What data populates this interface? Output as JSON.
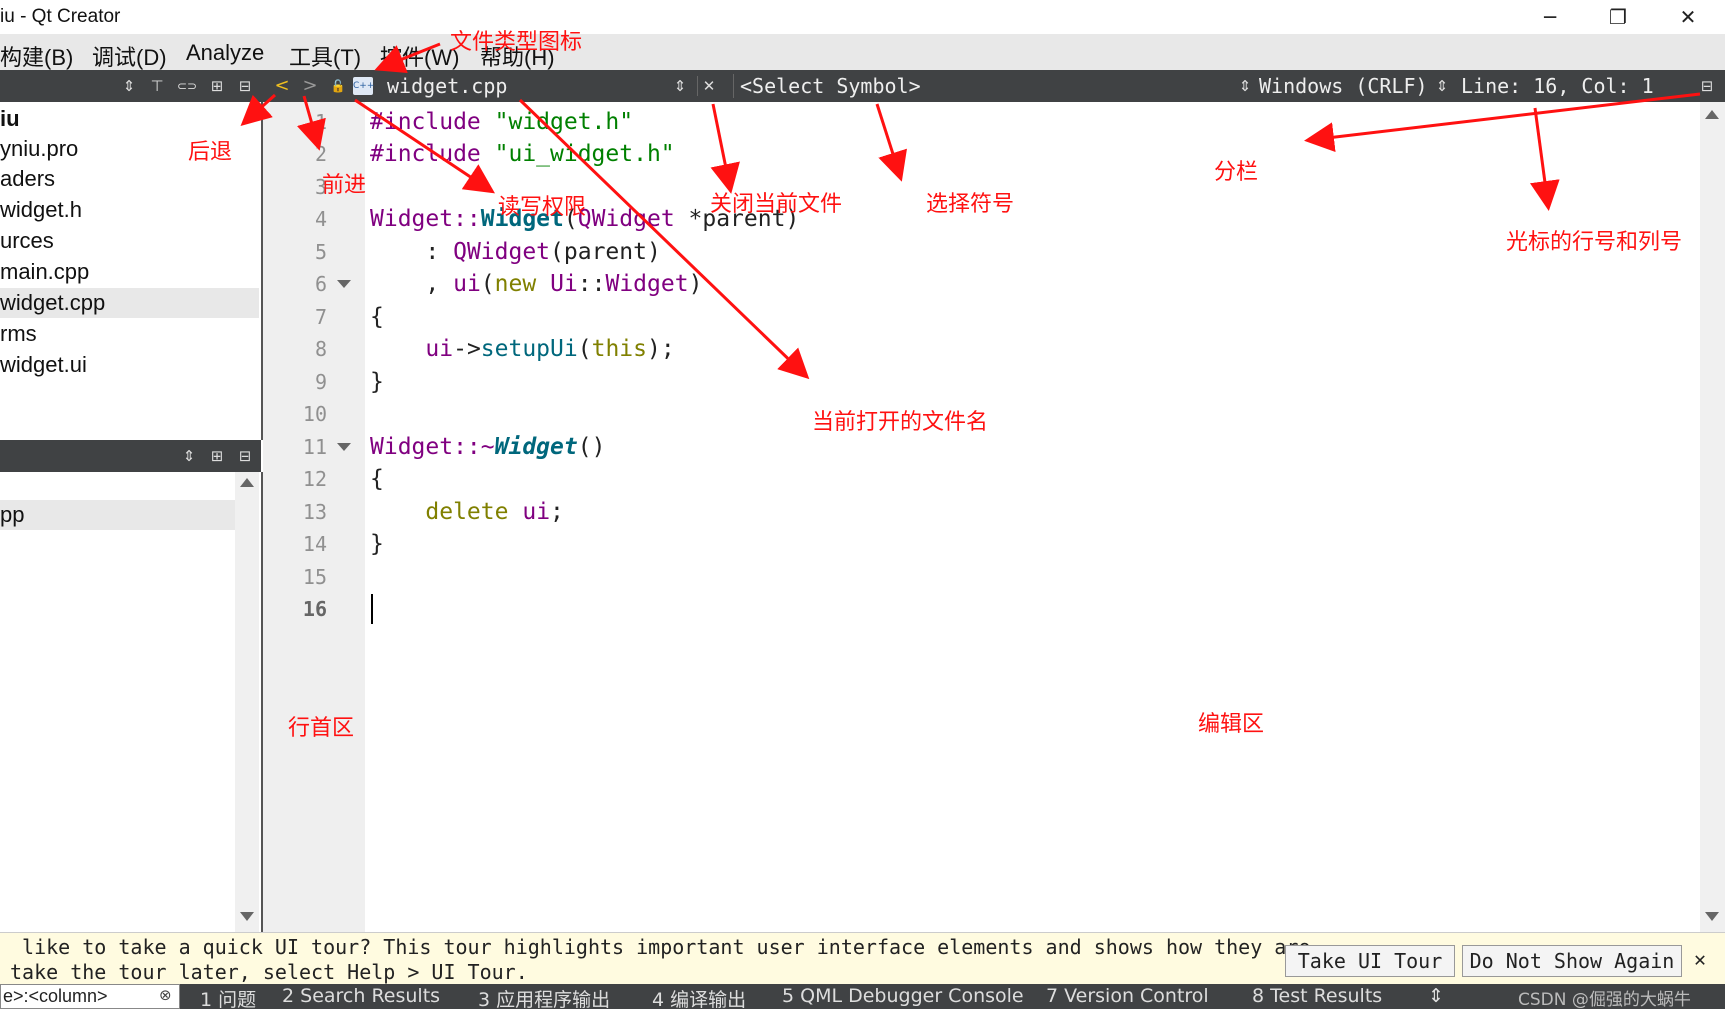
{
  "window": {
    "title": "iu - Qt Creator",
    "minimize": "─",
    "restore": "❐",
    "close": "✕"
  },
  "menu": [
    "构建(B)",
    "调试(D)",
    "Analyze",
    "工具(T)",
    "控件(W)",
    "帮助(H)"
  ],
  "left_toolbar": {
    "sort": "⇕",
    "filter": "⊤",
    "link": "⊂⊃",
    "split": "⊞",
    "close": "⊟"
  },
  "project_tree": [
    "iu",
    "yniu.pro",
    "aders",
    "widget.h",
    "urces",
    "main.cpp",
    "widget.cpp",
    "rms",
    "widget.ui"
  ],
  "open_files": {
    "item": "pp"
  },
  "editor_toolbar": {
    "back": "<",
    "forward": ">",
    "lock": "🔓",
    "file_type_icon": "C++",
    "file_name": "widget.cpp",
    "file_arrow": "⇕",
    "close_file": "✕",
    "symbol": "<Select Symbol>",
    "symbol_arrow": "⇕",
    "line_ending": "Windows (CRLF)",
    "line_ending_arrow": "⇕",
    "position": "Line: 16, Col: 1",
    "split": "⊟"
  },
  "line_numbers": [
    "1",
    "2",
    "3",
    "4",
    "5",
    "6",
    "7",
    "8",
    "9",
    "10",
    "11",
    "12",
    "13",
    "14",
    "15",
    "16"
  ],
  "code": {
    "l1a": "#include ",
    "l1b": "\"widget.h\"",
    "l2a": "#include ",
    "l2b": "\"ui_widget.h\"",
    "l4a": "Widget::",
    "l4b": "Widget",
    "l4c": "(",
    "l4d": "QWidget",
    "l4e": " *parent)",
    "l5a": "    : ",
    "l5b": "QWidget",
    "l5c": "(parent)",
    "l6a": "    , ",
    "l6b": "ui",
    "l6c": "(",
    "l6d": "new",
    "l6e": " ",
    "l6f": "Ui",
    "l6g": "::",
    "l6h": "Widget",
    "l6i": ")",
    "l7": "{",
    "l8a": "    ",
    "l8b": "ui",
    "l8c": "->",
    "l8d": "setupUi",
    "l8e": "(",
    "l8f": "this",
    "l8g": ");",
    "l9": "}",
    "l11a": "Widget::~",
    "l11b": "Widget",
    "l11c": "()",
    "l12": "{",
    "l13a": "    ",
    "l13b": "delete",
    "l13c": " ",
    "l13d": "ui",
    "l13e": ";",
    "l14": "}"
  },
  "tour": {
    "line1": " like to take a quick UI tour? This tour highlights important user interface elements and shows how they are",
    "line2": "take the tour later, select Help > UI Tour.",
    "take": "Take UI Tour",
    "dont": "Do Not Show Again",
    "close": "✕"
  },
  "status": {
    "locator": "e>:<column>",
    "locator_clear": "⊗",
    "tabs": [
      "1 问题",
      "2 Search Results",
      "3 应用程序输出",
      "4 编译输出",
      "5 QML Debugger Console",
      "7 Version Control",
      "8 Test Results"
    ],
    "more": "⇕"
  },
  "annotations": {
    "file_type_icon": "文件类型图标",
    "back": "后退",
    "forward": "前进",
    "rw": "读写权限",
    "close_file": "关闭当前文件",
    "select_symbol": "选择符号",
    "split": "分栏",
    "cursor_pos": "光标的行号和列号",
    "current_file": "当前打开的文件名",
    "gutter": "行首区",
    "editor": "编辑区"
  },
  "watermark": "CSDN @倔强的大蜗牛",
  "colors": {
    "annotation": "#ff1111",
    "toolbar": "#404244",
    "gutter": "#efefef"
  }
}
